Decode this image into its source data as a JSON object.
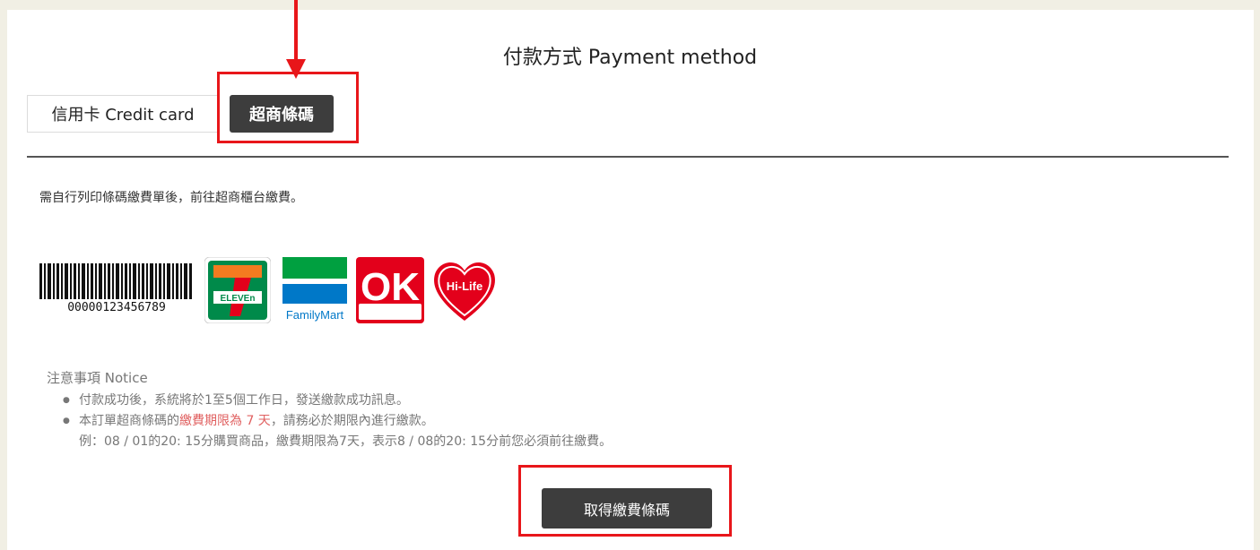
{
  "page": {
    "title": "付款方式 Payment method"
  },
  "tabs": [
    {
      "label": "信用卡 Credit card",
      "active": false
    },
    {
      "label": "超商條碼",
      "active": true
    }
  ],
  "description": "需自行列印條碼繳費單後，前往超商櫃台繳費。",
  "barcode": {
    "number": "00000123456789"
  },
  "stores": [
    {
      "name": "7-ELEVEN",
      "logo_text": "ELEVEn",
      "icon": "seven-eleven-logo"
    },
    {
      "name": "FamilyMart",
      "logo_text": "FamilyMart",
      "icon": "familymart-logo"
    },
    {
      "name": "OK",
      "logo_text": "OK",
      "icon": "ok-mart-logo"
    },
    {
      "name": "Hi-Life",
      "logo_text": "Hi-Life",
      "icon": "hi-life-logo"
    }
  ],
  "notice": {
    "title": "注意事項 Notice",
    "item1": "付款成功後，系統將於1至5個工作日，發送繳款成功訊息。",
    "item2_prefix": "本訂單超商條碼的",
    "item2_highlight": "繳費期限為 7 天",
    "item2_suffix": "，請務必於期限內進行繳款。",
    "example": "例：08 / 01的20: 15分購買商品，繳費期限為7天，表示8 / 08的20: 15分前您必須前往繳費。"
  },
  "button": {
    "label": "取得繳費條碼"
  },
  "colors": {
    "background": "#f1efe4",
    "panel": "#ffffff",
    "dark_button": "#3d3d3d",
    "highlight": "#e8161a",
    "notice_red": "#e06060"
  }
}
